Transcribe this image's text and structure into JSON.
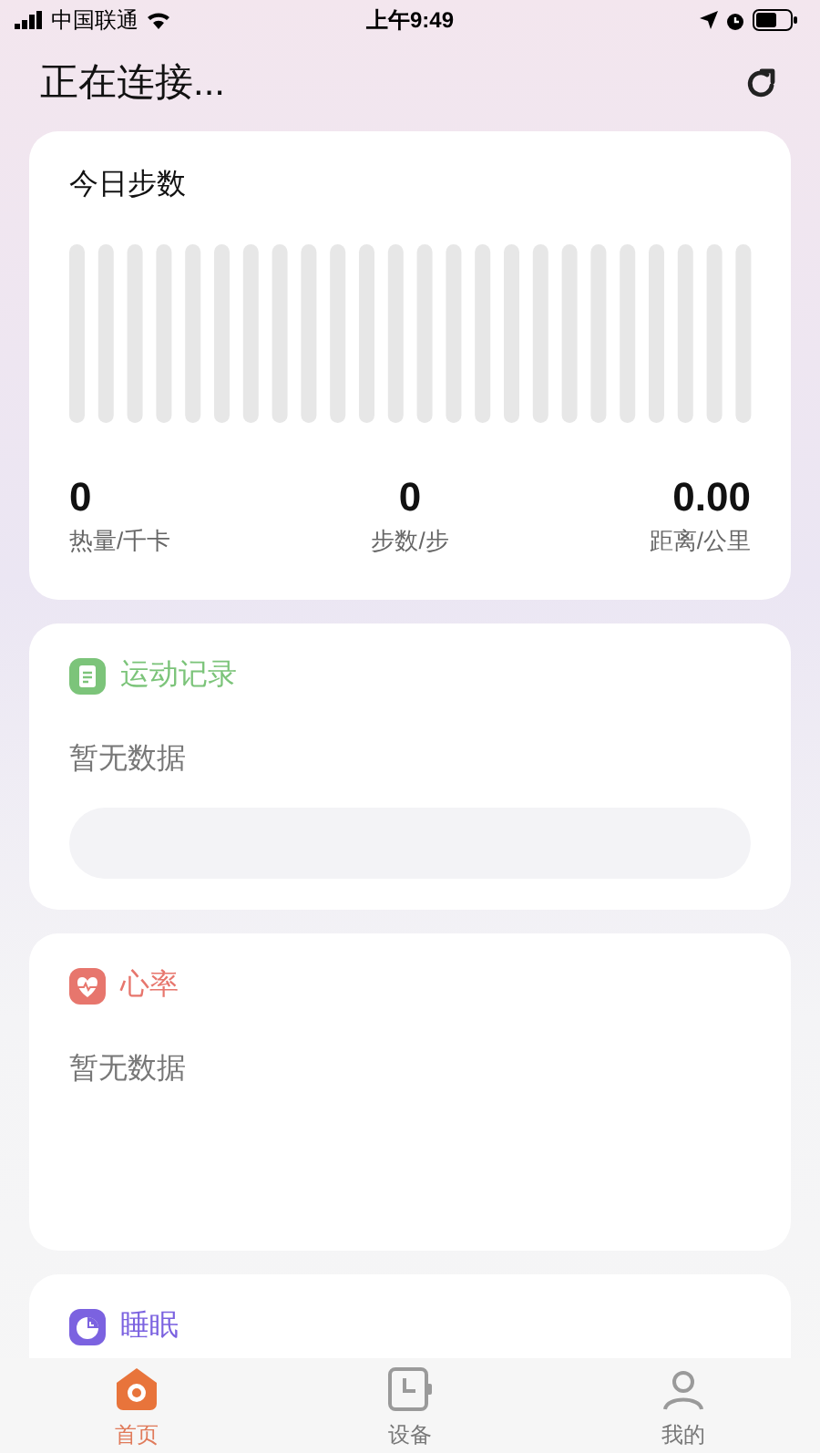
{
  "status_bar": {
    "carrier": "中国联通",
    "time": "上午9:49"
  },
  "header": {
    "title": "正在连接..."
  },
  "steps_card": {
    "title": "今日步数",
    "stats": [
      {
        "value": "0",
        "label": "热量/千卡"
      },
      {
        "value": "0",
        "label": "步数/步"
      },
      {
        "value": "0.00",
        "label": "距离/公里"
      }
    ]
  },
  "sections": [
    {
      "kind": "records",
      "title": "运动记录",
      "color": "#7cc47a",
      "empty_text": "暂无数据"
    },
    {
      "kind": "heart",
      "title": "心率",
      "color": "#e7766d",
      "empty_text": "暂无数据"
    },
    {
      "kind": "sleep",
      "title": "睡眠",
      "color": "#7b62e0"
    }
  ],
  "tab_bar": [
    {
      "kind": "home",
      "label": "首页",
      "selected": true
    },
    {
      "kind": "device",
      "label": "设备",
      "selected": false
    },
    {
      "kind": "me",
      "label": "我的",
      "selected": false
    }
  ]
}
